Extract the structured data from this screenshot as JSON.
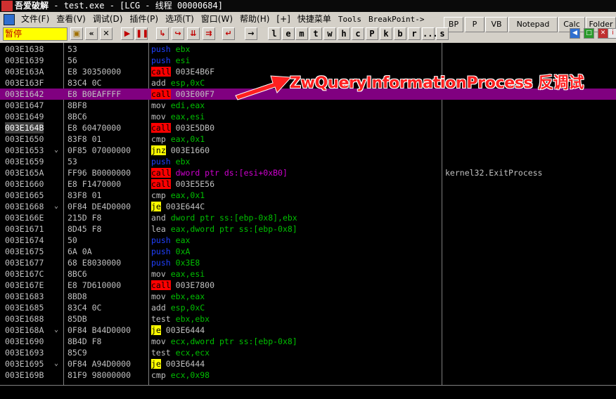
{
  "title": {
    "app": "吾爱破解",
    "rest": " - test.exe - [LCG -  线程  00000684]"
  },
  "menu": [
    {
      "label": "文件(F)"
    },
    {
      "label": "查看(V)"
    },
    {
      "label": "调试(D)"
    },
    {
      "label": "插件(P)"
    },
    {
      "label": "选项(T)"
    },
    {
      "label": "窗口(W)"
    },
    {
      "label": "帮助(H)"
    },
    {
      "label": "[+]"
    },
    {
      "label": "快捷菜单"
    },
    {
      "label": "Tools"
    },
    {
      "label": "BreakPoint->"
    }
  ],
  "right_buttons": [
    "BP",
    "P",
    "VB",
    "Notepad",
    "Calc",
    "Folder"
  ],
  "status": "暂停",
  "toolbar_letters": [
    "l",
    "e",
    "m",
    "t",
    "w",
    "h",
    "c",
    "P",
    "k",
    "b",
    "r",
    "...",
    "s"
  ],
  "annotation": "ZwQueryInformationProcess 反调试",
  "rows": [
    {
      "addr": "003E1638",
      "hex": "53",
      "op": "push",
      "opnd": "ebx",
      "kind": "push"
    },
    {
      "addr": "003E1639",
      "hex": "56",
      "op": "push",
      "opnd": "esi",
      "kind": "push"
    },
    {
      "addr": "003E163A",
      "hex": "E8 30350000",
      "op": "call",
      "opnd": "003E4B6F",
      "kind": "call"
    },
    {
      "addr": "003E163F",
      "hex": "83C4 0C",
      "op": "add",
      "opnd": "esp,0xC",
      "kind": "plain"
    },
    {
      "addr": "003E1642",
      "hex": "E8 B0EAFFFF",
      "op": "call",
      "opnd": "003E00F7",
      "kind": "call",
      "sel": true
    },
    {
      "addr": "003E1647",
      "hex": "8BF8",
      "op": "mov",
      "opnd": "edi,eax",
      "kind": "plain"
    },
    {
      "addr": "003E1649",
      "hex": "8BC6",
      "op": "mov",
      "opnd": "eax,esi",
      "kind": "plain"
    },
    {
      "addr": "003E164B",
      "hex": "E8 60470000",
      "op": "call",
      "opnd": "003E5DB0",
      "kind": "call",
      "bold": true
    },
    {
      "addr": "003E1650",
      "hex": "83F8 01",
      "op": "cmp",
      "opnd": "eax,0x1",
      "kind": "plain"
    },
    {
      "addr": "003E1653",
      "hex": "0F85 07000000",
      "op": "jnz",
      "opnd": "003E1660",
      "kind": "jump",
      "jm": true
    },
    {
      "addr": "003E1659",
      "hex": "53",
      "op": "push",
      "opnd": "ebx",
      "kind": "push"
    },
    {
      "addr": "003E165A",
      "hex": "FF96 B0000000",
      "op": "call",
      "opnd": "dword ptr ds:[esi+0xB0]",
      "kind": "call",
      "cmt": "kernel32.ExitProcess",
      "strop": true
    },
    {
      "addr": "003E1660",
      "hex": "E8 F1470000",
      "op": "call",
      "opnd": "003E5E56",
      "kind": "call"
    },
    {
      "addr": "003E1665",
      "hex": "83F8 01",
      "op": "cmp",
      "opnd": "eax,0x1",
      "kind": "plain"
    },
    {
      "addr": "003E1668",
      "hex": "0F84 DE4D0000",
      "op": "je",
      "opnd": "003E644C",
      "kind": "jump",
      "jm": true
    },
    {
      "addr": "003E166E",
      "hex": "215D F8",
      "op": "and",
      "opnd": "dword ptr ss:[ebp-0x8],ebx",
      "kind": "plain"
    },
    {
      "addr": "003E1671",
      "hex": "8D45 F8",
      "op": "lea",
      "opnd": "eax,dword ptr ss:[ebp-0x8]",
      "kind": "plain"
    },
    {
      "addr": "003E1674",
      "hex": "50",
      "op": "push",
      "opnd": "eax",
      "kind": "push"
    },
    {
      "addr": "003E1675",
      "hex": "6A 0A",
      "op": "push",
      "opnd": "0xA",
      "kind": "push"
    },
    {
      "addr": "003E1677",
      "hex": "68 E8030000",
      "op": "push",
      "opnd": "0x3E8",
      "kind": "push"
    },
    {
      "addr": "003E167C",
      "hex": "8BC6",
      "op": "mov",
      "opnd": "eax,esi",
      "kind": "plain"
    },
    {
      "addr": "003E167E",
      "hex": "E8 7D610000",
      "op": "call",
      "opnd": "003E7800",
      "kind": "call"
    },
    {
      "addr": "003E1683",
      "hex": "8BD8",
      "op": "mov",
      "opnd": "ebx,eax",
      "kind": "plain"
    },
    {
      "addr": "003E1685",
      "hex": "83C4 0C",
      "op": "add",
      "opnd": "esp,0xC",
      "kind": "plain"
    },
    {
      "addr": "003E1688",
      "hex": "85DB",
      "op": "test",
      "opnd": "ebx,ebx",
      "kind": "plain"
    },
    {
      "addr": "003E168A",
      "hex": "0F84 B44D0000",
      "op": "je",
      "opnd": "003E6444",
      "kind": "jump",
      "jm": true
    },
    {
      "addr": "003E1690",
      "hex": "8B4D F8",
      "op": "mov",
      "opnd": "ecx,dword ptr ss:[ebp-0x8]",
      "kind": "plain"
    },
    {
      "addr": "003E1693",
      "hex": "85C9",
      "op": "test",
      "opnd": "ecx,ecx",
      "kind": "plain"
    },
    {
      "addr": "003E1695",
      "hex": "0F84 A94D0000",
      "op": "je",
      "opnd": "003E6444",
      "kind": "jump",
      "jm": true
    },
    {
      "addr": "003E169B",
      "hex": "81F9 98000000",
      "op": "cmp",
      "opnd": "ecx,0x98",
      "kind": "plain"
    }
  ]
}
